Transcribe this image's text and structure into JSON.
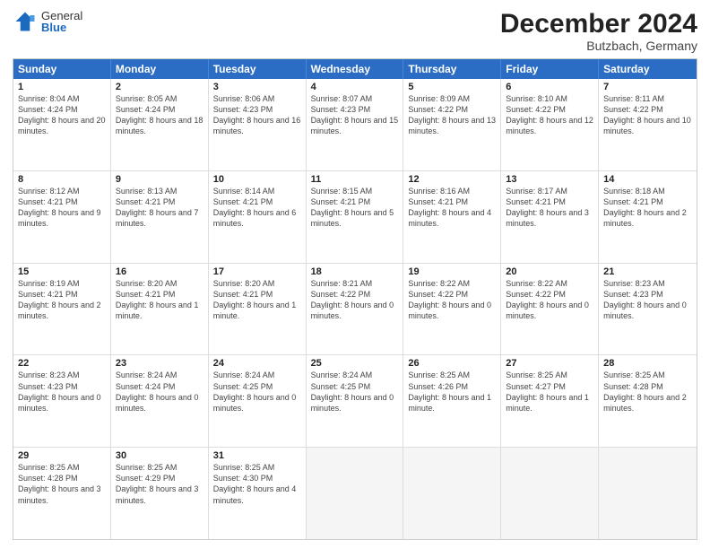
{
  "header": {
    "logo": {
      "general": "General",
      "blue": "Blue"
    },
    "title": "December 2024",
    "location": "Butzbach, Germany"
  },
  "weekdays": [
    "Sunday",
    "Monday",
    "Tuesday",
    "Wednesday",
    "Thursday",
    "Friday",
    "Saturday"
  ],
  "rows": [
    [
      {
        "day": "1",
        "sunrise": "8:04 AM",
        "sunset": "4:24 PM",
        "daylight": "8 hours and 20 minutes."
      },
      {
        "day": "2",
        "sunrise": "8:05 AM",
        "sunset": "4:24 PM",
        "daylight": "8 hours and 18 minutes."
      },
      {
        "day": "3",
        "sunrise": "8:06 AM",
        "sunset": "4:23 PM",
        "daylight": "8 hours and 16 minutes."
      },
      {
        "day": "4",
        "sunrise": "8:07 AM",
        "sunset": "4:23 PM",
        "daylight": "8 hours and 15 minutes."
      },
      {
        "day": "5",
        "sunrise": "8:09 AM",
        "sunset": "4:22 PM",
        "daylight": "8 hours and 13 minutes."
      },
      {
        "day": "6",
        "sunrise": "8:10 AM",
        "sunset": "4:22 PM",
        "daylight": "8 hours and 12 minutes."
      },
      {
        "day": "7",
        "sunrise": "8:11 AM",
        "sunset": "4:22 PM",
        "daylight": "8 hours and 10 minutes."
      }
    ],
    [
      {
        "day": "8",
        "sunrise": "8:12 AM",
        "sunset": "4:21 PM",
        "daylight": "8 hours and 9 minutes."
      },
      {
        "day": "9",
        "sunrise": "8:13 AM",
        "sunset": "4:21 PM",
        "daylight": "8 hours and 7 minutes."
      },
      {
        "day": "10",
        "sunrise": "8:14 AM",
        "sunset": "4:21 PM",
        "daylight": "8 hours and 6 minutes."
      },
      {
        "day": "11",
        "sunrise": "8:15 AM",
        "sunset": "4:21 PM",
        "daylight": "8 hours and 5 minutes."
      },
      {
        "day": "12",
        "sunrise": "8:16 AM",
        "sunset": "4:21 PM",
        "daylight": "8 hours and 4 minutes."
      },
      {
        "day": "13",
        "sunrise": "8:17 AM",
        "sunset": "4:21 PM",
        "daylight": "8 hours and 3 minutes."
      },
      {
        "day": "14",
        "sunrise": "8:18 AM",
        "sunset": "4:21 PM",
        "daylight": "8 hours and 2 minutes."
      }
    ],
    [
      {
        "day": "15",
        "sunrise": "8:19 AM",
        "sunset": "4:21 PM",
        "daylight": "8 hours and 2 minutes."
      },
      {
        "day": "16",
        "sunrise": "8:20 AM",
        "sunset": "4:21 PM",
        "daylight": "8 hours and 1 minute."
      },
      {
        "day": "17",
        "sunrise": "8:20 AM",
        "sunset": "4:21 PM",
        "daylight": "8 hours and 1 minute."
      },
      {
        "day": "18",
        "sunrise": "8:21 AM",
        "sunset": "4:22 PM",
        "daylight": "8 hours and 0 minutes."
      },
      {
        "day": "19",
        "sunrise": "8:22 AM",
        "sunset": "4:22 PM",
        "daylight": "8 hours and 0 minutes."
      },
      {
        "day": "20",
        "sunrise": "8:22 AM",
        "sunset": "4:22 PM",
        "daylight": "8 hours and 0 minutes."
      },
      {
        "day": "21",
        "sunrise": "8:23 AM",
        "sunset": "4:23 PM",
        "daylight": "8 hours and 0 minutes."
      }
    ],
    [
      {
        "day": "22",
        "sunrise": "8:23 AM",
        "sunset": "4:23 PM",
        "daylight": "8 hours and 0 minutes."
      },
      {
        "day": "23",
        "sunrise": "8:24 AM",
        "sunset": "4:24 PM",
        "daylight": "8 hours and 0 minutes."
      },
      {
        "day": "24",
        "sunrise": "8:24 AM",
        "sunset": "4:25 PM",
        "daylight": "8 hours and 0 minutes."
      },
      {
        "day": "25",
        "sunrise": "8:24 AM",
        "sunset": "4:25 PM",
        "daylight": "8 hours and 0 minutes."
      },
      {
        "day": "26",
        "sunrise": "8:25 AM",
        "sunset": "4:26 PM",
        "daylight": "8 hours and 1 minute."
      },
      {
        "day": "27",
        "sunrise": "8:25 AM",
        "sunset": "4:27 PM",
        "daylight": "8 hours and 1 minute."
      },
      {
        "day": "28",
        "sunrise": "8:25 AM",
        "sunset": "4:28 PM",
        "daylight": "8 hours and 2 minutes."
      }
    ],
    [
      {
        "day": "29",
        "sunrise": "8:25 AM",
        "sunset": "4:28 PM",
        "daylight": "8 hours and 3 minutes."
      },
      {
        "day": "30",
        "sunrise": "8:25 AM",
        "sunset": "4:29 PM",
        "daylight": "8 hours and 3 minutes."
      },
      {
        "day": "31",
        "sunrise": "8:25 AM",
        "sunset": "4:30 PM",
        "daylight": "8 hours and 4 minutes."
      },
      null,
      null,
      null,
      null
    ]
  ]
}
